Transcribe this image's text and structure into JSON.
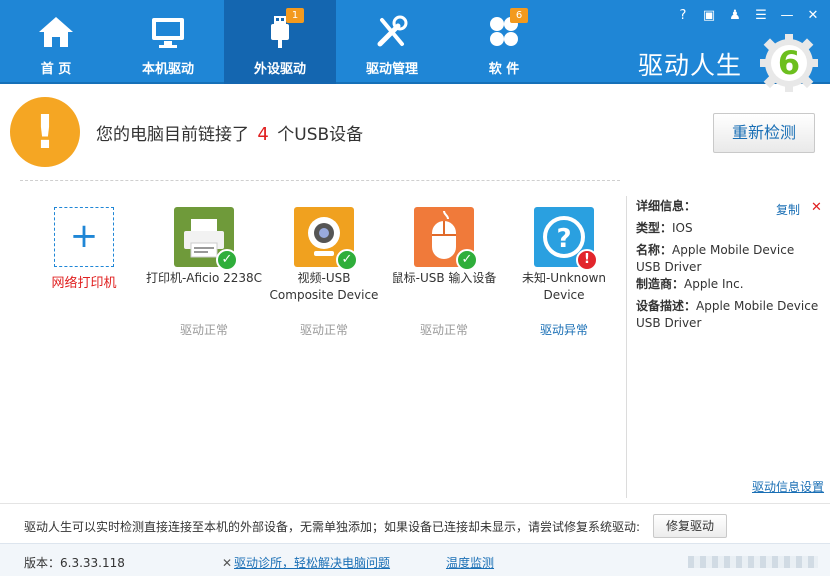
{
  "nav": {
    "items": [
      {
        "label": "首 页",
        "icon": "home-icon",
        "badge": ""
      },
      {
        "label": "本机驱动",
        "icon": "monitor-icon",
        "badge": ""
      },
      {
        "label": "外设驱动",
        "icon": "usb-icon",
        "badge": "1",
        "active": true
      },
      {
        "label": "驱动管理",
        "icon": "tools-icon",
        "badge": ""
      },
      {
        "label": "软 件",
        "icon": "apps-icon",
        "badge": "6"
      }
    ],
    "brand": "驱动人生",
    "logo_digit": "6"
  },
  "window_controls": [
    "help-icon",
    "feedback-icon",
    "skin-icon",
    "menu-icon",
    "minimize-icon",
    "close-icon"
  ],
  "header": {
    "prefix": "您的电脑目前链接了",
    "count": "4",
    "suffix": "个USB设备",
    "redetect_label": "重新检测"
  },
  "add_printer": {
    "label": "网络打印机"
  },
  "devices": [
    {
      "name": "打印机-Aficio 2238C",
      "status": "驱动正常",
      "icon": "printer-icon",
      "color": "#6f9a3a",
      "ok": true
    },
    {
      "name": "视频-USB Composite Device",
      "status": "驱动正常",
      "icon": "webcam-icon",
      "color": "#f0a11f",
      "ok": true
    },
    {
      "name": "鼠标-USB 输入设备",
      "status": "驱动正常",
      "icon": "mouse-icon",
      "color": "#f07a3a",
      "ok": true
    },
    {
      "name": "未知-Unknown Device",
      "status": "驱动异常",
      "icon": "unknown-device-icon",
      "color": "#2aa0e0",
      "ok": false
    }
  ],
  "detail": {
    "title": "详细信息：",
    "copy_label": "复制",
    "type_label": "类型：",
    "type_value": "IOS",
    "name_label": "名称：",
    "name_value": "Apple Mobile Device USB Driver",
    "maker_label": "制造商：",
    "maker_value": "Apple Inc.",
    "desc_label": "设备描述：",
    "desc_value": "Apple Mobile Device USB Driver",
    "settings_link": "驱动信息设置"
  },
  "infobar": {
    "text": "驱动人生可以实时检测直接连接至本机的外部设备，无需单独添加；如果设备已连接却未显示，请尝试修复系统驱动:",
    "repair_label": "修复驱动"
  },
  "footer": {
    "version": "版本：6.3.33.118",
    "diag_link": "驱动诊所，轻松解决电脑问题",
    "temp_link": "温度监测"
  },
  "colors": {
    "accent": "#1f86d6",
    "nav_active": "#1466b0",
    "warning": "#f5a623",
    "error": "#e02020",
    "link": "#1a6fb5"
  }
}
